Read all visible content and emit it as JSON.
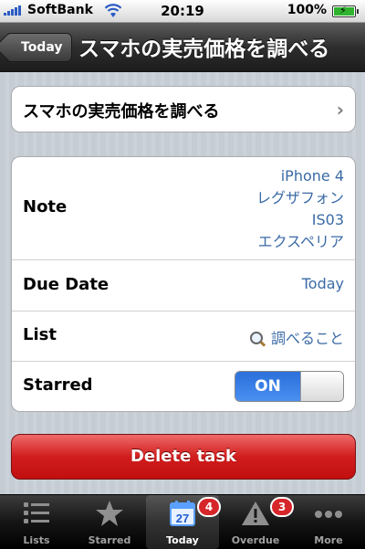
{
  "status_bar": {
    "carrier": "SoftBank",
    "time": "20:19",
    "battery": "100%"
  },
  "nav": {
    "back_label": "Today",
    "title": "スマホの実売価格を調べる"
  },
  "task": {
    "title": "スマホの実売価格を調べる"
  },
  "details": {
    "note_label": "Note",
    "note_lines": [
      "iPhone 4",
      "レグザフォン",
      "IS03",
      "エクスペリア"
    ],
    "due_label": "Due Date",
    "due_value": "Today",
    "list_label": "List",
    "list_value": "調べること",
    "starred_label": "Starred",
    "starred_toggle": "ON"
  },
  "delete_label": "Delete task",
  "tabs": [
    {
      "label": "Lists",
      "icon": "list-icon"
    },
    {
      "label": "Starred",
      "icon": "star-icon"
    },
    {
      "label": "Today",
      "icon": "calendar-icon",
      "icon_text": "27",
      "badge": "4"
    },
    {
      "label": "Overdue",
      "icon": "warning-icon",
      "badge": "3"
    },
    {
      "label": "More",
      "icon": "more-icon"
    }
  ],
  "colors": {
    "accent": "#3a6aa5",
    "delete": "#d11d1d",
    "toggle_on": "#2a6fdb"
  }
}
